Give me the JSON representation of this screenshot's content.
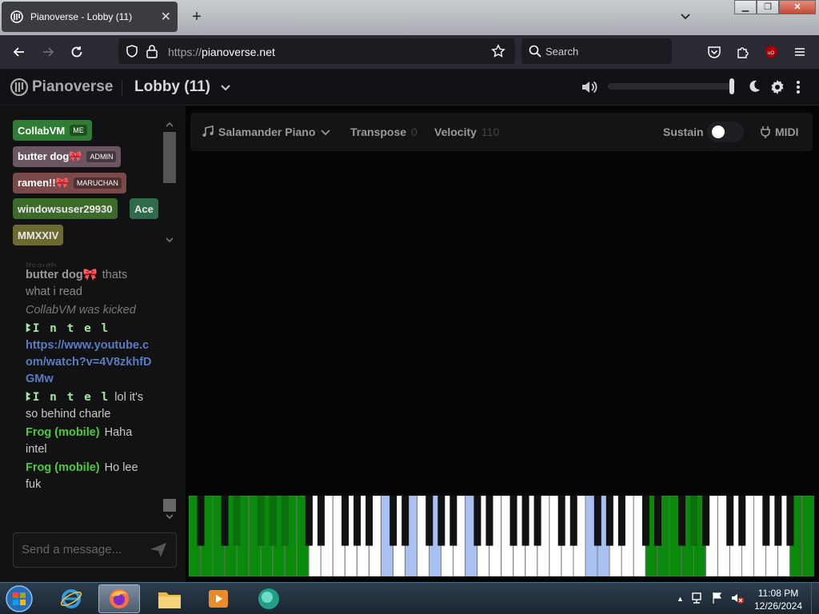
{
  "browser": {
    "tab_title": "Pianoverse - Lobby (11)",
    "url_prefix": "https://",
    "url_host": "pianoverse.net",
    "search_placeholder": "Search"
  },
  "app": {
    "logo_text": "Pianoverse",
    "room_name": "Lobby (11)",
    "volume_level": 0.97
  },
  "users": [
    {
      "name": "CollabVM",
      "badge": "ME",
      "color": "#2e7d32",
      "text": "#fff"
    },
    {
      "name": "butter dog🎀",
      "badge": "ADMIN",
      "color": "#6a5660",
      "text": "#fff"
    },
    {
      "name": "ramen!!🎀",
      "badge": "MARUCHAN",
      "color": "#7a4a4a",
      "text": "#fff"
    },
    {
      "name": "windowsuser29930",
      "badge": "",
      "color": "#3c6a2a",
      "text": "#e8e8e8"
    },
    {
      "name": "Ace",
      "badge": "",
      "color": "#2f6a4a",
      "text": "#e8e8e8"
    },
    {
      "name": "MMXXIV",
      "badge": "",
      "color": "#6b6a30",
      "text": "#e8e8e8"
    }
  ],
  "chat": {
    "faded_top": "Itsauth",
    "messages": [
      {
        "name": "butter dog🎀",
        "name_color": "#9a9a9a",
        "text": "thats what i read",
        "text_color": "#8a8a8a"
      },
      {
        "name": "",
        "name_color": "#777",
        "text": "CollabVM was kicked",
        "text_color": "#777",
        "italic": true
      },
      {
        "name": "ꔪI n t e l",
        "name_color": "#9fe89f",
        "text": "https://www.youtube.com/watch?v=4V8zkhfDGMw",
        "text_color": "#5a7cc0"
      },
      {
        "name": "ꔪI n t e l",
        "name_color": "#9fe89f",
        "text": "lol it's so behind charle",
        "text_color": "#c8c8c8"
      },
      {
        "name": "Frog (mobile)",
        "name_color": "#4ccb3a",
        "text": "Haha intel",
        "text_color": "#c8c8c8"
      },
      {
        "name": "Frog (mobile)",
        "name_color": "#4ccb3a",
        "text": "Ho lee fuk",
        "text_color": "#c8c8c8"
      }
    ],
    "input_placeholder": "Send a message..."
  },
  "toolbar": {
    "instrument": "Salamander Piano",
    "transpose_label": "Transpose",
    "transpose_value": "0",
    "velocity_label": "Velocity",
    "velocity_value": "110",
    "sustain_label": "Sustain",
    "midi_label": "MIDI"
  },
  "piano": {
    "white_key_count": 52,
    "pressed_white_green": [
      0,
      1,
      2,
      3,
      4,
      5,
      6,
      7,
      8,
      9,
      38,
      39,
      40,
      41,
      42,
      50,
      51
    ],
    "pressed_white_blue": [
      16,
      18,
      20,
      23,
      33,
      34
    ],
    "pressed_black_green": [
      2,
      3,
      4,
      5,
      29
    ]
  },
  "taskbar": {
    "time": "11:08 PM",
    "date": "12/26/2024"
  }
}
